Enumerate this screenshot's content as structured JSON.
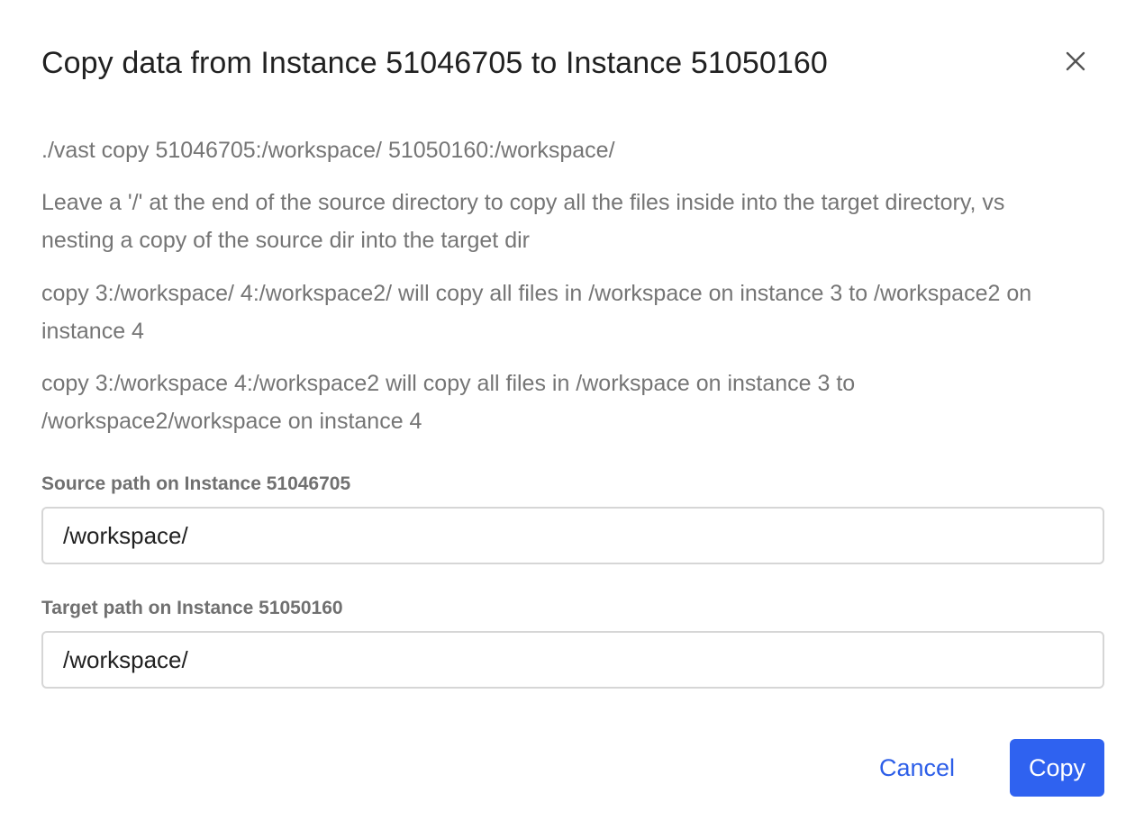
{
  "dialog": {
    "title": "Copy data from Instance 51046705 to Instance 51050160",
    "close_icon": "close-icon",
    "command": "./vast copy 51046705:/workspace/ 51050160:/workspace/",
    "help_paragraphs": [
      "Leave a '/' at the end of the source directory to copy all the files inside into the target directory, vs nesting a copy of the source dir into the target dir",
      "copy 3:/workspace/ 4:/workspace2/ will copy all files in /workspace on instance 3 to /workspace2 on instance 4",
      "copy 3:/workspace 4:/workspace2 will copy all files in /workspace on instance 3 to /workspace2/workspace on instance 4"
    ],
    "source": {
      "label": "Source path on Instance 51046705",
      "value": "/workspace/"
    },
    "target": {
      "label": "Target path on Instance 51050160",
      "value": "/workspace/"
    },
    "actions": {
      "cancel_label": "Cancel",
      "copy_label": "Copy"
    },
    "colors": {
      "accent": "#2f62f0",
      "link": "#2c5ee8",
      "body_text": "#757575"
    }
  }
}
